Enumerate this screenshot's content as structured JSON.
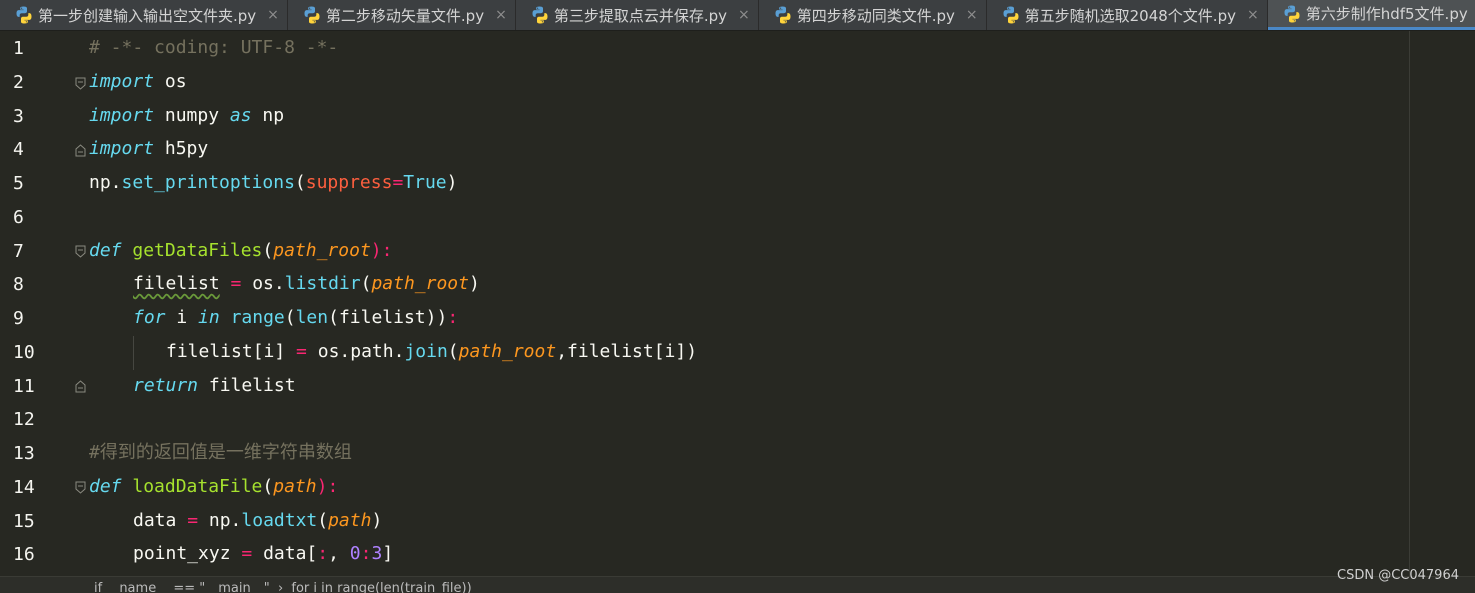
{
  "tabs": [
    {
      "label": "第一步创建输入输出空文件夹.py",
      "close": "×",
      "active": false
    },
    {
      "label": "第二步移动矢量文件.py",
      "close": "×",
      "active": false
    },
    {
      "label": "第三步提取点云并保存.py",
      "close": "×",
      "active": false
    },
    {
      "label": "第四步移动同类文件.py",
      "close": "×",
      "active": false
    },
    {
      "label": "第五步随机选取2048个文件.py",
      "close": "×",
      "active": false
    },
    {
      "label": "第六步制作hdf5文件.py",
      "close": "×",
      "active": true
    }
  ],
  "line_numbers": [
    "1",
    "2",
    "3",
    "4",
    "5",
    "6",
    "7",
    "8",
    "9",
    "10",
    "11",
    "12",
    "13",
    "14",
    "15",
    "16"
  ],
  "code": {
    "l1": {
      "comment": "# -*- coding: UTF-8 -*-"
    },
    "l2": {
      "kw": "import",
      "rest": " os"
    },
    "l3": {
      "kw": "import",
      "rest": " numpy ",
      "as": "as",
      "alias": " np"
    },
    "l4": {
      "kw": "import",
      "rest": " h5py"
    },
    "l5": {
      "obj": "np.",
      "fn": "set_printoptions",
      "open": "(",
      "kwarg": "suppress",
      "eq": "=",
      "val": "True",
      "close": ")"
    },
    "l7": {
      "kw": "def",
      "fn": " getDataFiles",
      "open": "(",
      "param": "path_root",
      "close": "):"
    },
    "l8": {
      "var": "filelist",
      "eq": " = ",
      "obj": "os.",
      "fn": "listdir",
      "open": "(",
      "param": "path_root",
      "close": ")"
    },
    "l9": {
      "kw": "for",
      "i": " i ",
      "in": "in",
      "sp": " ",
      "range": "range",
      "open": "(",
      "len": "len",
      "arg": "(filelist))",
      "colon": ":"
    },
    "l10": {
      "lhs": "filelist[i]",
      "eq": " = ",
      "obj": "os.path.",
      "fn": "join",
      "open": "(",
      "param": "path_root",
      "rest": ",filelist[i])"
    },
    "l11": {
      "kw": "return",
      "rest": " filelist"
    },
    "l13": {
      "comment": "#得到的返回值是一维字符串数组"
    },
    "l14": {
      "kw": "def",
      "fn": " loadDataFile",
      "open": "(",
      "param": "path",
      "close": "):"
    },
    "l15": {
      "var": "data",
      "eq": " = ",
      "obj": "np.",
      "fn": "loadtxt",
      "open": "(",
      "param": "path",
      "close": ")"
    },
    "l16": {
      "var": "point_xyz",
      "eq": " = ",
      "obj": "data[",
      "colon": ":",
      "comma": ", ",
      "n0": "0",
      "colon2": ":",
      "n3": "3",
      "close": "]"
    }
  },
  "breadcrumb": "if __name__ == \"__main__\"  ›  for i in range(len(train_file))",
  "watermark": "CSDN @CC047964",
  "colors": {
    "background": "#272822",
    "keyword": "#66d9ef",
    "function": "#a6e22e",
    "parameter": "#fd971f",
    "operator": "#f92672",
    "number": "#ae81ff",
    "comment": "#75715e"
  }
}
